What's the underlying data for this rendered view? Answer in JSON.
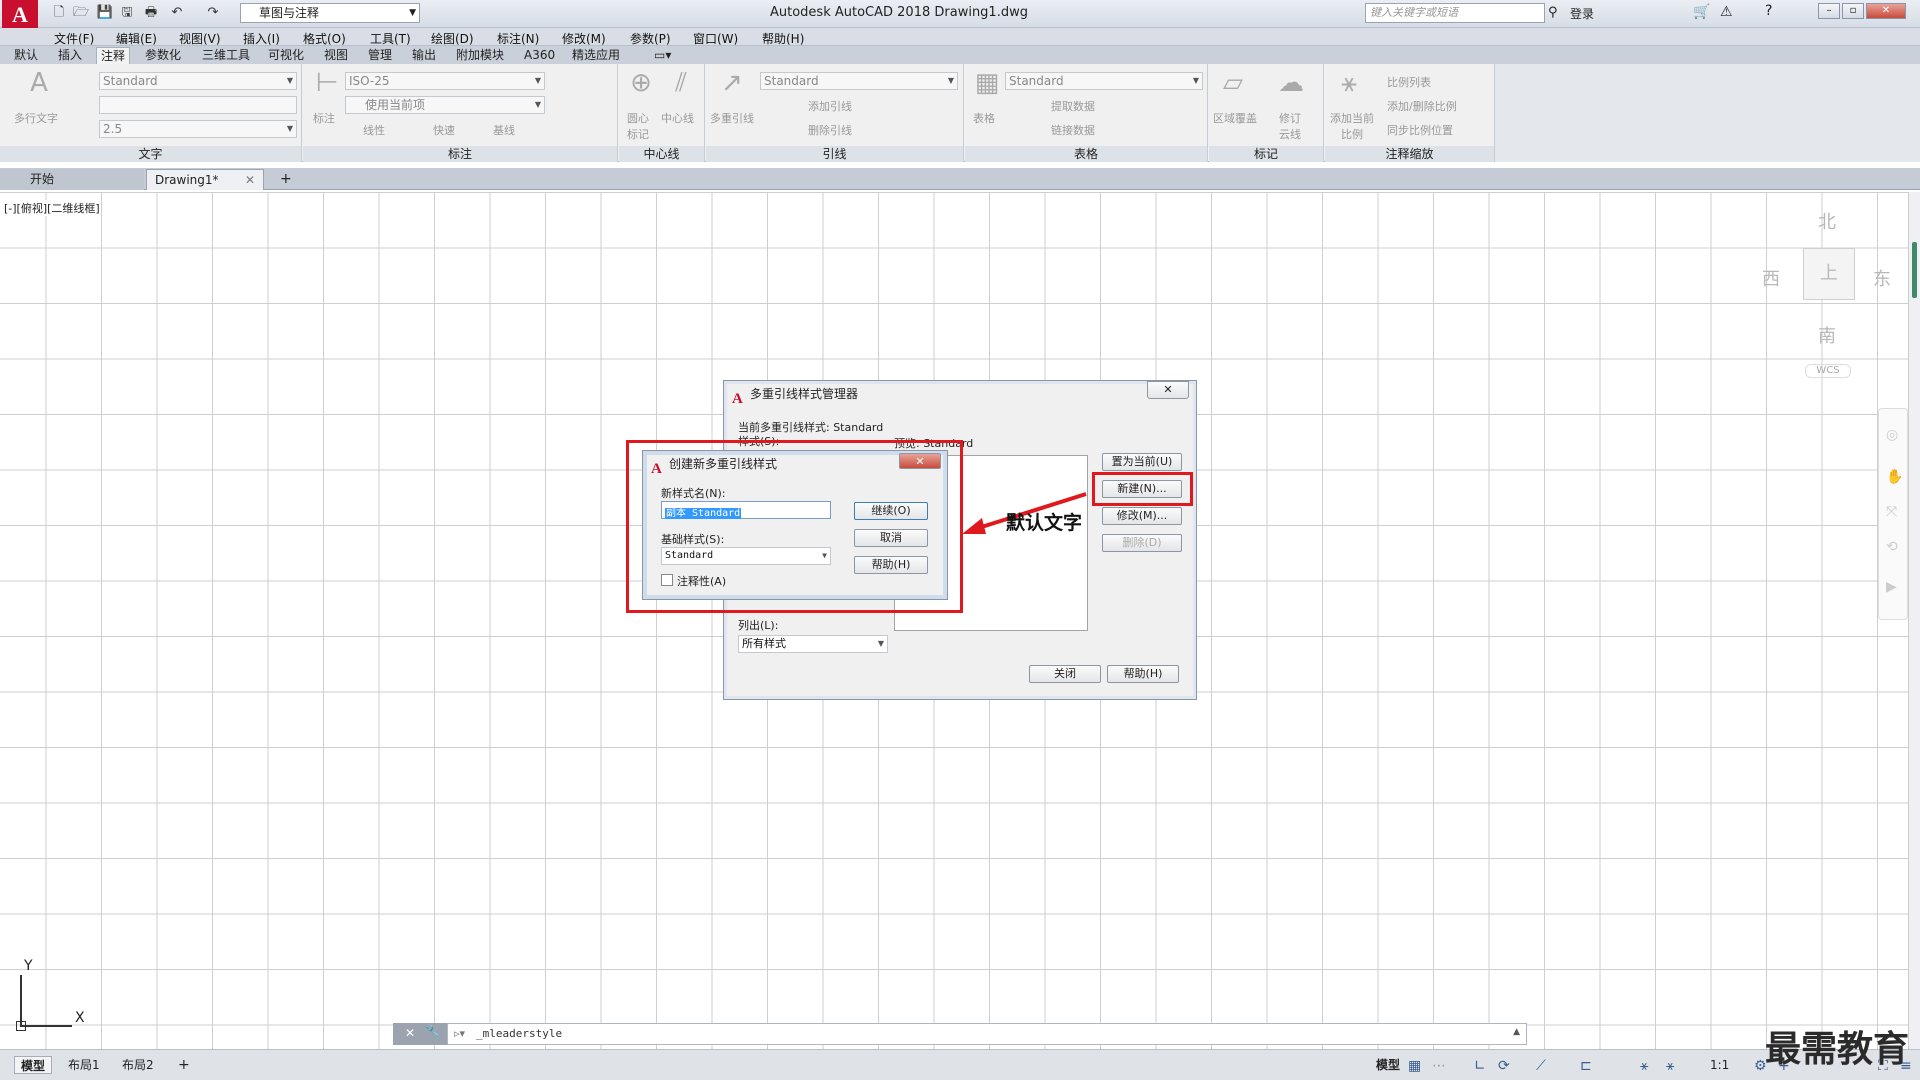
{
  "titlebar": {
    "workspace": "草图与注释",
    "title": "Autodesk AutoCAD 2018    Drawing1.dwg",
    "search_placeholder": "键入关键字或短语",
    "login": "登录"
  },
  "menu": [
    "文件(F)",
    "编辑(E)",
    "视图(V)",
    "插入(I)",
    "格式(O)",
    "工具(T)",
    "绘图(D)",
    "标注(N)",
    "修改(M)",
    "参数(P)",
    "窗口(W)",
    "帮助(H)"
  ],
  "ribbon_tabs": [
    "默认",
    "插入",
    "注释",
    "参数化",
    "三维工具",
    "可视化",
    "视图",
    "管理",
    "输出",
    "附加模块",
    "A360",
    "精选应用"
  ],
  "ribbon_active_tab": "注释",
  "ribbon": {
    "text_panel": {
      "title": "文字",
      "big_label": "多行文字",
      "style": "Standard",
      "height": "2.5"
    },
    "dim_panel": {
      "title": "标注",
      "big_label": "标注",
      "style": "ISO-25",
      "layer": "使用当前项",
      "linear": "线性",
      "quick": "快速",
      "baseline": "基线"
    },
    "center_panel": {
      "title": "中心线",
      "center_mark": "圆心标记",
      "centerline": "中心线"
    },
    "leader_panel": {
      "title": "引线",
      "big_label": "多重引线",
      "style": "Standard",
      "add": "添加引线",
      "remove": "删除引线"
    },
    "table_panel": {
      "title": "表格",
      "big_label": "表格",
      "style": "Standard",
      "extract": "提取数据",
      "link": "链接数据"
    },
    "mark_panel": {
      "title": "标记",
      "wipeout": "区域覆盖",
      "revcloud": "修订云线"
    },
    "scale_panel": {
      "title": "注释缩放",
      "add_current": "添加当前比例",
      "list": "比例列表",
      "add_delete": "添加/删除比例",
      "sync": "同步比例位置"
    }
  },
  "doc_tabs": {
    "start": "开始",
    "drawing": "Drawing1*"
  },
  "viewport_label": "[-][俯视][二维线框]",
  "viewcube": {
    "north": "北",
    "south": "南",
    "east": "东",
    "west": "西",
    "top": "上",
    "wcs": "WCS"
  },
  "ucs": {
    "x": "X",
    "y": "Y"
  },
  "manager_dialog": {
    "title": "多重引线样式管理器",
    "current_style": "当前多重引线样式: Standard",
    "styles_label": "样式(S):",
    "preview_label": "预览: Standard",
    "set_current": "置为当前(U)",
    "new": "新建(N)...",
    "modify": "修改(M)...",
    "delete": "删除(D)",
    "list_label": "列出(L):",
    "list_value": "所有样式",
    "close": "关闭",
    "help": "帮助(H)"
  },
  "create_dialog": {
    "title": "创建新多重引线样式",
    "new_name_label": "新样式名(N):",
    "new_name_value": "副本 Standard",
    "base_label": "基础样式(S):",
    "base_value": "Standard",
    "annotative": "注释性(A)",
    "continue": "继续(O)",
    "cancel": "取消",
    "help": "帮助(H)"
  },
  "annotation": {
    "text": "默认文字",
    "color": "#e0191f"
  },
  "command_line": "_mleaderstyle",
  "status_tabs": [
    "模型",
    "布局1",
    "布局2"
  ],
  "status": {
    "model": "模型",
    "scale": "1:1"
  },
  "watermark": "最需教育"
}
